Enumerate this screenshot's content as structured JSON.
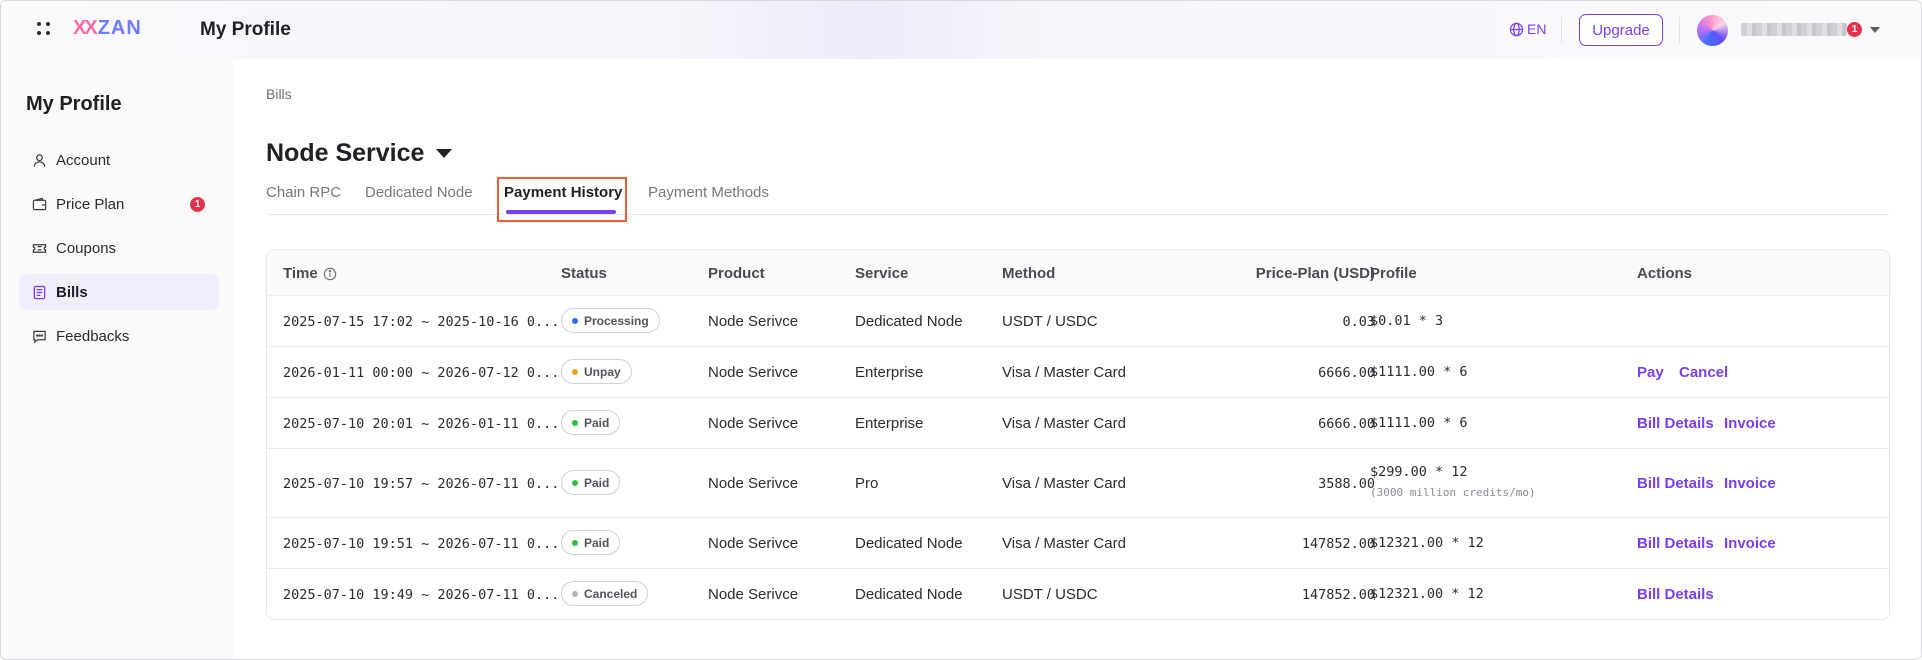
{
  "header": {
    "logo_mark": "XX",
    "logo_text": "ZAN",
    "title": "My Profile",
    "language": "EN",
    "upgrade_label": "Upgrade",
    "notification_count": "1"
  },
  "sidebar": {
    "title": "My Profile",
    "items": [
      {
        "label": "Account",
        "icon": "user-icon"
      },
      {
        "label": "Price Plan",
        "icon": "wallet-icon",
        "badge": "1"
      },
      {
        "label": "Coupons",
        "icon": "ticket-icon"
      },
      {
        "label": "Bills",
        "icon": "document-icon",
        "active": true
      },
      {
        "label": "Feedbacks",
        "icon": "chat-icon"
      }
    ]
  },
  "main": {
    "breadcrumb": "Bills",
    "service_title": "Node Service",
    "tabs": [
      {
        "label": "Chain RPC"
      },
      {
        "label": "Dedicated Node"
      },
      {
        "label": "Payment History",
        "active": true
      },
      {
        "label": "Payment Methods"
      }
    ],
    "table": {
      "columns": [
        "Time",
        "Status",
        "Product",
        "Service",
        "Method",
        "Price-Plan (USD)",
        "Profile",
        "Actions"
      ],
      "rows": [
        {
          "time": "2025-07-15 17:02 ~ 2025-10-16 0...",
          "status": "Processing",
          "status_color": "#2f6bff",
          "product": "Node Serivce",
          "service": "Dedicated Node",
          "method": "USDT / USDC",
          "price": "0.03",
          "profile": "$0.01 * 3",
          "profile_sub": "",
          "actions": []
        },
        {
          "time": "2026-01-11 00:00 ~ 2026-07-12 0...",
          "status": "Unpay",
          "status_color": "#f0a020",
          "product": "Node Serivce",
          "service": "Enterprise",
          "method": "Visa / Master Card",
          "price": "6666.00",
          "profile": "$1111.00 * 6",
          "profile_sub": "",
          "actions": [
            "Pay",
            "Cancel"
          ]
        },
        {
          "time": "2025-07-10 20:01 ~ 2026-01-11 0...",
          "status": "Paid",
          "status_color": "#2fbf3f",
          "product": "Node Serivce",
          "service": "Enterprise",
          "method": "Visa / Master Card",
          "price": "6666.00",
          "profile": "$1111.00 * 6",
          "profile_sub": "",
          "actions": [
            "Bill Details",
            "Invoice"
          ]
        },
        {
          "time": "2025-07-10 19:57 ~ 2026-07-11 0...",
          "status": "Paid",
          "status_color": "#2fbf3f",
          "product": "Node Serivce",
          "service": "Pro",
          "method": "Visa / Master Card",
          "price": "3588.00",
          "profile": "$299.00 * 12",
          "profile_sub": "(3000 million credits/mo)",
          "actions": [
            "Bill Details",
            "Invoice"
          ]
        },
        {
          "time": "2025-07-10 19:51 ~ 2026-07-11 0...",
          "status": "Paid",
          "status_color": "#2fbf3f",
          "product": "Node Serivce",
          "service": "Dedicated Node",
          "method": "Visa / Master Card",
          "price": "147852.00",
          "profile": "$12321.00 * 12",
          "profile_sub": "",
          "actions": [
            "Bill Details",
            "Invoice"
          ]
        },
        {
          "time": "2025-07-10 19:49 ~ 2026-07-11 0...",
          "status": "Canceled",
          "status_color": "#b5b5bd",
          "product": "Node Serivce",
          "service": "Dedicated Node",
          "method": "USDT / USDC",
          "price": "147852.00",
          "profile": "$12321.00 * 12",
          "profile_sub": "",
          "actions": [
            "Bill Details"
          ]
        }
      ]
    }
  },
  "colors": {
    "accent": "#7b3ff2",
    "badge": "#e5334b",
    "highlight": "#ef5b32"
  }
}
